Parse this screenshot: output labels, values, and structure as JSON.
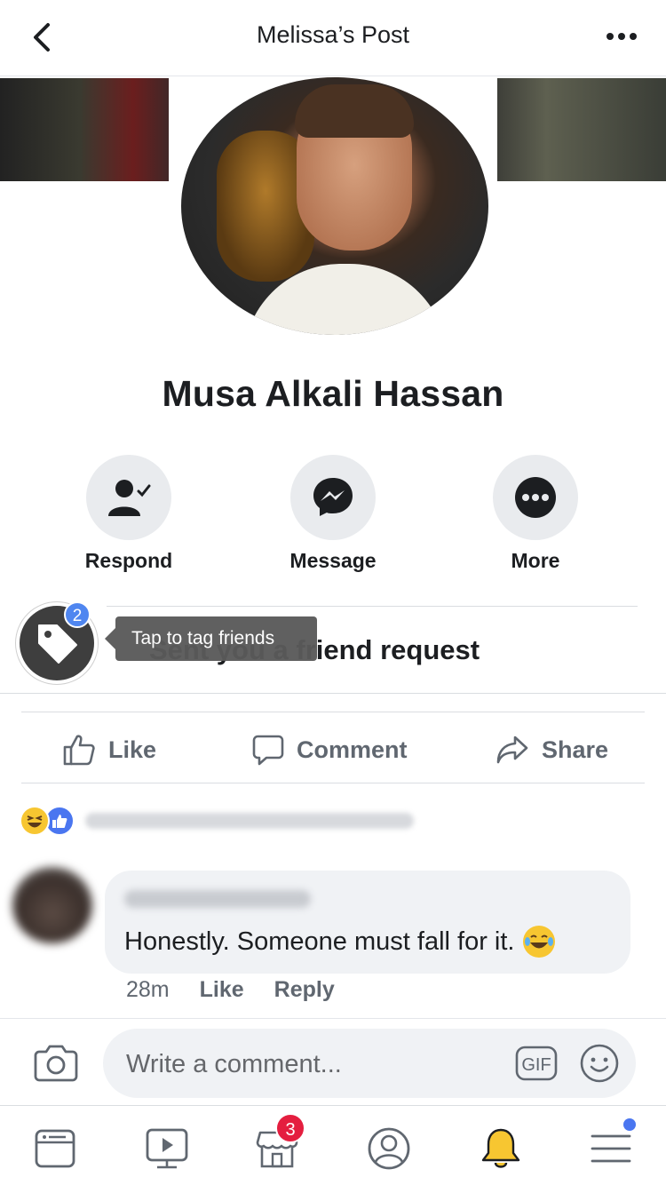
{
  "header": {
    "title": "Melissa’s Post",
    "back_icon": "chevron-left-icon",
    "more_icon": "more-dots-icon"
  },
  "profile": {
    "name": "Musa Alkali Hassan"
  },
  "actions": [
    {
      "label": "Respond",
      "icon": "person-check-icon"
    },
    {
      "label": "Message",
      "icon": "messenger-icon"
    },
    {
      "label": "More",
      "icon": "more-dots-icon"
    }
  ],
  "post": {
    "headline": "Sent you a friend request"
  },
  "tag_tooltip": {
    "text": "Tap to tag friends",
    "badge_count": "2"
  },
  "reaction_buttons": [
    {
      "label": "Like",
      "icon": "thumbs-up-icon"
    },
    {
      "label": "Comment",
      "icon": "comment-icon"
    },
    {
      "label": "Share",
      "icon": "share-icon"
    }
  ],
  "comment": {
    "text": "Honestly. Someone must fall for it.",
    "time": "28m",
    "like_label": "Like",
    "reply_label": "Reply"
  },
  "composer": {
    "placeholder": "Write a comment...",
    "gif_label": "GIF"
  },
  "tabbar": {
    "marketplace_badge": "3",
    "items": [
      "news-feed-icon",
      "watch-icon",
      "marketplace-icon",
      "profile-icon",
      "notifications-bell-icon",
      "menu-icon"
    ]
  },
  "colors": {
    "accent_blue": "#4a76f0",
    "badge_red": "#e41e3f",
    "bell_yellow": "#f7c631",
    "muted_text": "#606770"
  }
}
